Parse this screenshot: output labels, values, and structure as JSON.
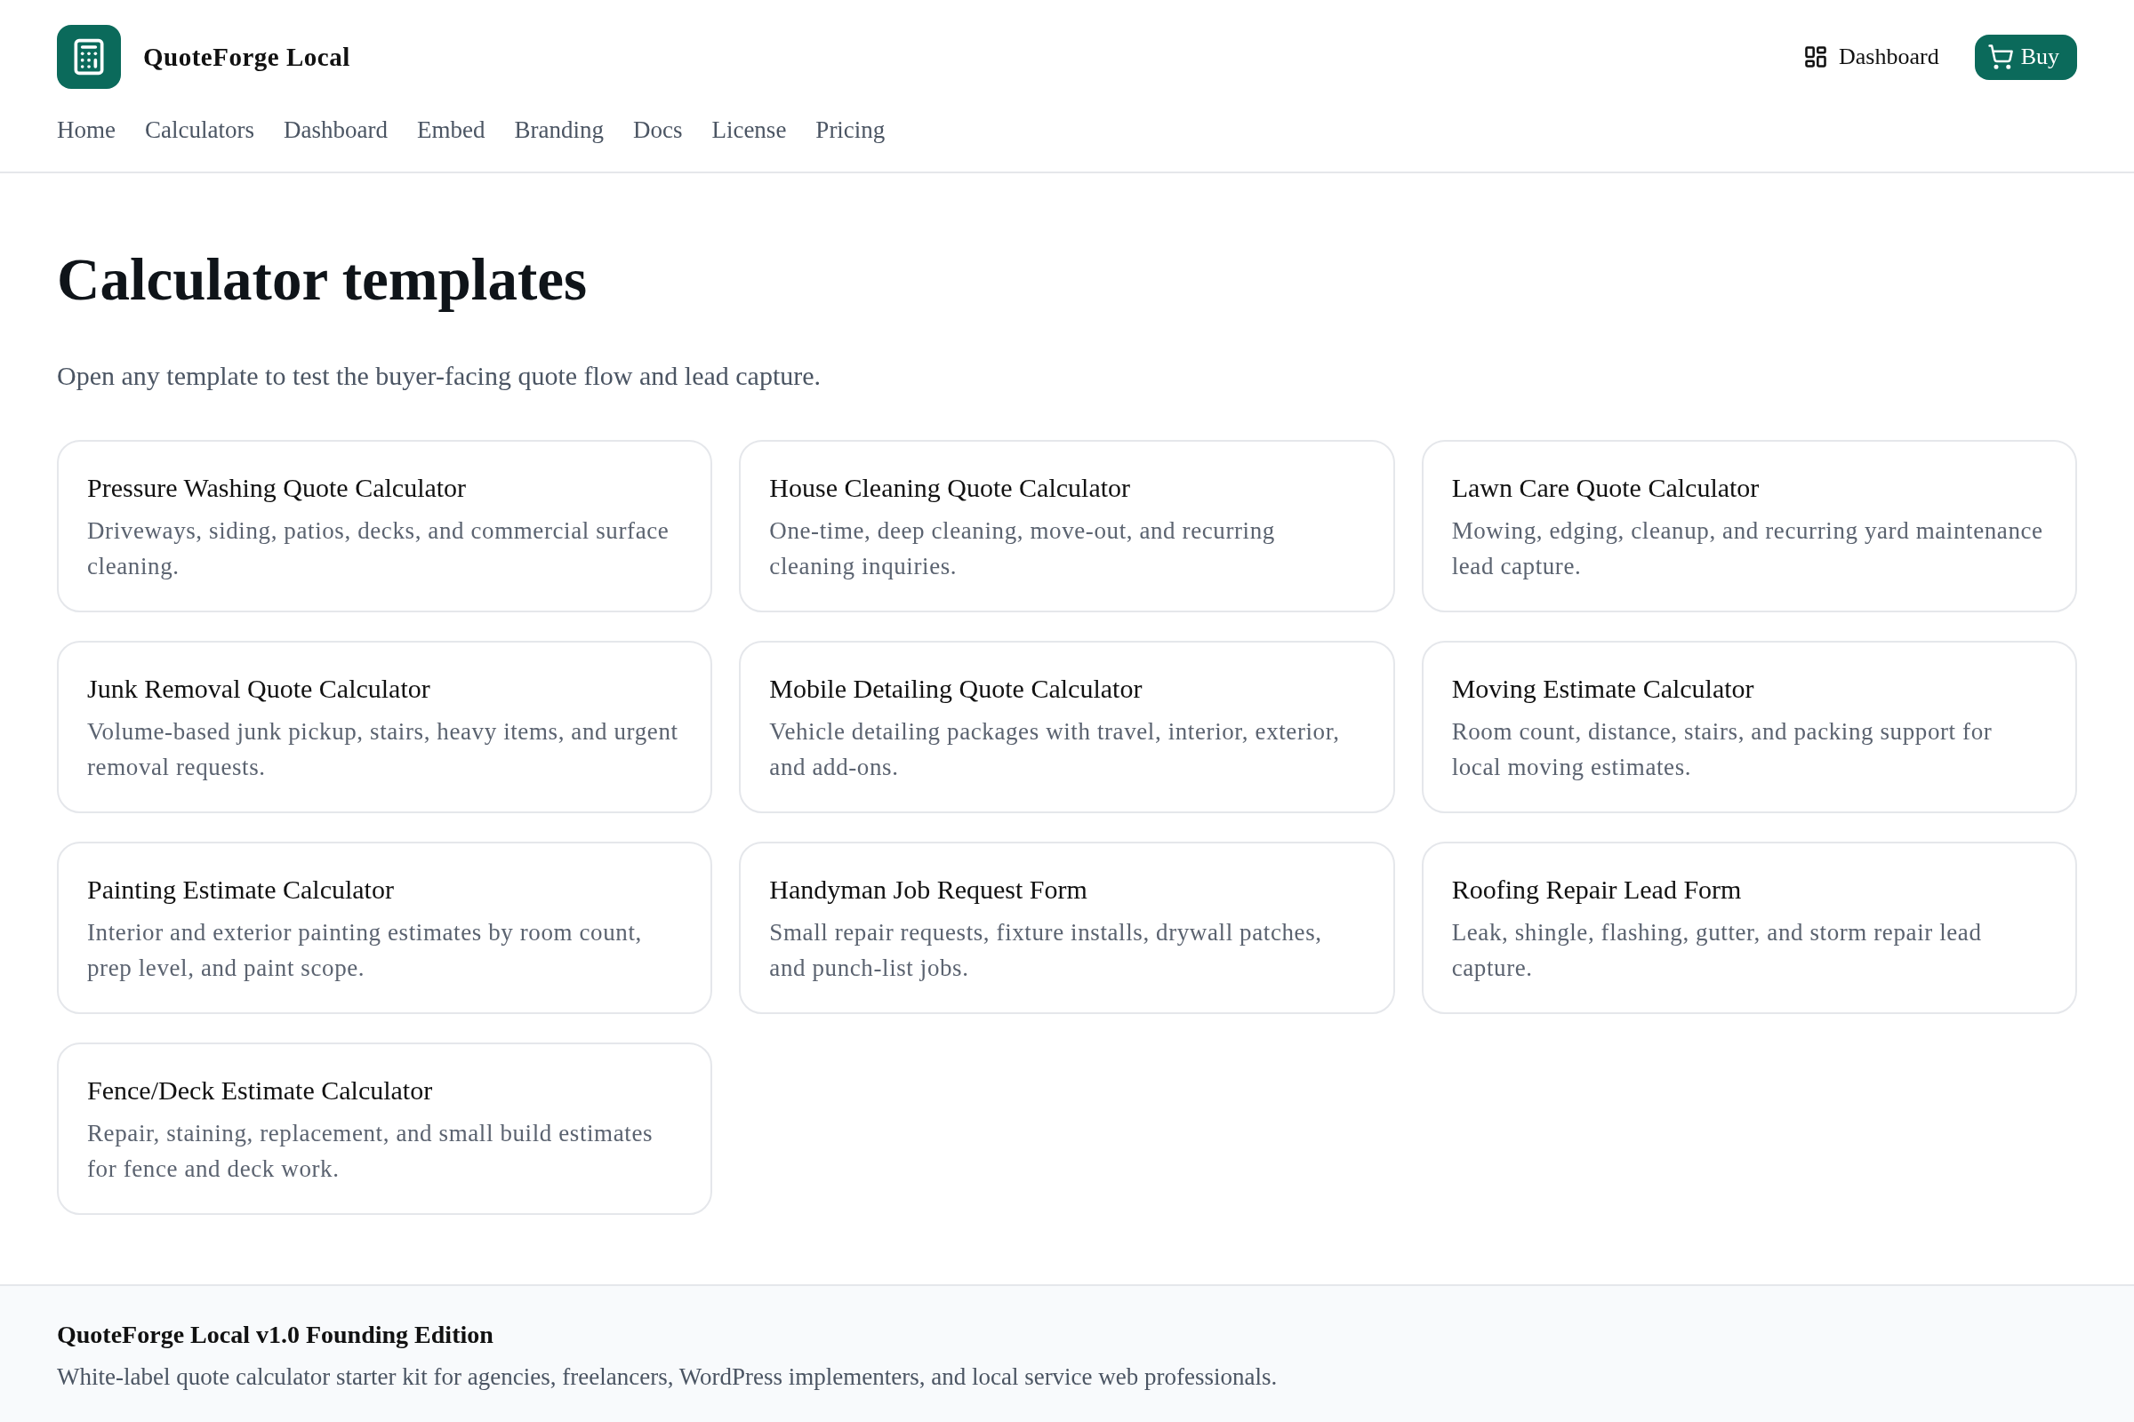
{
  "header": {
    "brand": "QuoteForge Local",
    "nav": [
      {
        "label": "Home"
      },
      {
        "label": "Calculators"
      },
      {
        "label": "Dashboard"
      },
      {
        "label": "Embed"
      },
      {
        "label": "Branding"
      },
      {
        "label": "Docs"
      },
      {
        "label": "License"
      },
      {
        "label": "Pricing"
      }
    ],
    "actions": [
      {
        "kind": "link",
        "label": "Dashboard"
      },
      {
        "kind": "primary",
        "label": "Buy"
      }
    ]
  },
  "page": {
    "title": "Calculator templates",
    "subtitle": "Open any template to test the buyer-facing quote flow and lead capture."
  },
  "templates": [
    {
      "title": "Pressure Washing Quote Calculator",
      "description": "Driveways, siding, patios, decks, and commercial surface cleaning."
    },
    {
      "title": "House Cleaning Quote Calculator",
      "description": "One-time, deep cleaning, move-out, and recurring cleaning inquiries."
    },
    {
      "title": "Lawn Care Quote Calculator",
      "description": "Mowing, edging, cleanup, and recurring yard maintenance lead capture."
    },
    {
      "title": "Junk Removal Quote Calculator",
      "description": "Volume-based junk pickup, stairs, heavy items, and urgent removal requests."
    },
    {
      "title": "Mobile Detailing Quote Calculator",
      "description": "Vehicle detailing packages with travel, interior, exterior, and add-ons."
    },
    {
      "title": "Moving Estimate Calculator",
      "description": "Room count, distance, stairs, and packing support for local moving estimates."
    },
    {
      "title": "Painting Estimate Calculator",
      "description": "Interior and exterior painting estimates by room count, prep level, and paint scope."
    },
    {
      "title": "Handyman Job Request Form",
      "description": "Small repair requests, fixture installs, drywall patches, and punch-list jobs."
    },
    {
      "title": "Roofing Repair Lead Form",
      "description": "Leak, shingle, flashing, gutter, and storm repair lead capture."
    },
    {
      "title": "Fence/Deck Estimate Calculator",
      "description": "Repair, staining, replacement, and small build estimates for fence and deck work."
    }
  ],
  "footer": {
    "title": "QuoteForge Local v1.0 Founding Edition",
    "description": "White-label quote calculator starter kit for agencies, freelancers, WordPress implementers, and local service web professionals."
  }
}
